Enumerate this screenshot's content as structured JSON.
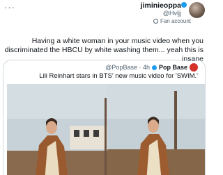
{
  "header": {
    "more_glyph": "···",
    "username": "jiminieoppa",
    "handle": "@Hvljj",
    "badge": "Fan account"
  },
  "tweet": {
    "text": "Having a white woman in your music video when you discriminated the HBCU by white washing them... yeah this is insane"
  },
  "quote": {
    "name": "Pop Base",
    "meta": "@PopBase · 4h",
    "text": "Lili Reinhart stars in BTS' new music video for 'SWIM.'"
  },
  "colors": {
    "verified": "#1d9bf0",
    "pop_base_avatar": "#d5312b"
  },
  "icons": [
    "more-icon",
    "verified-icon",
    "fan-account-icon"
  ]
}
